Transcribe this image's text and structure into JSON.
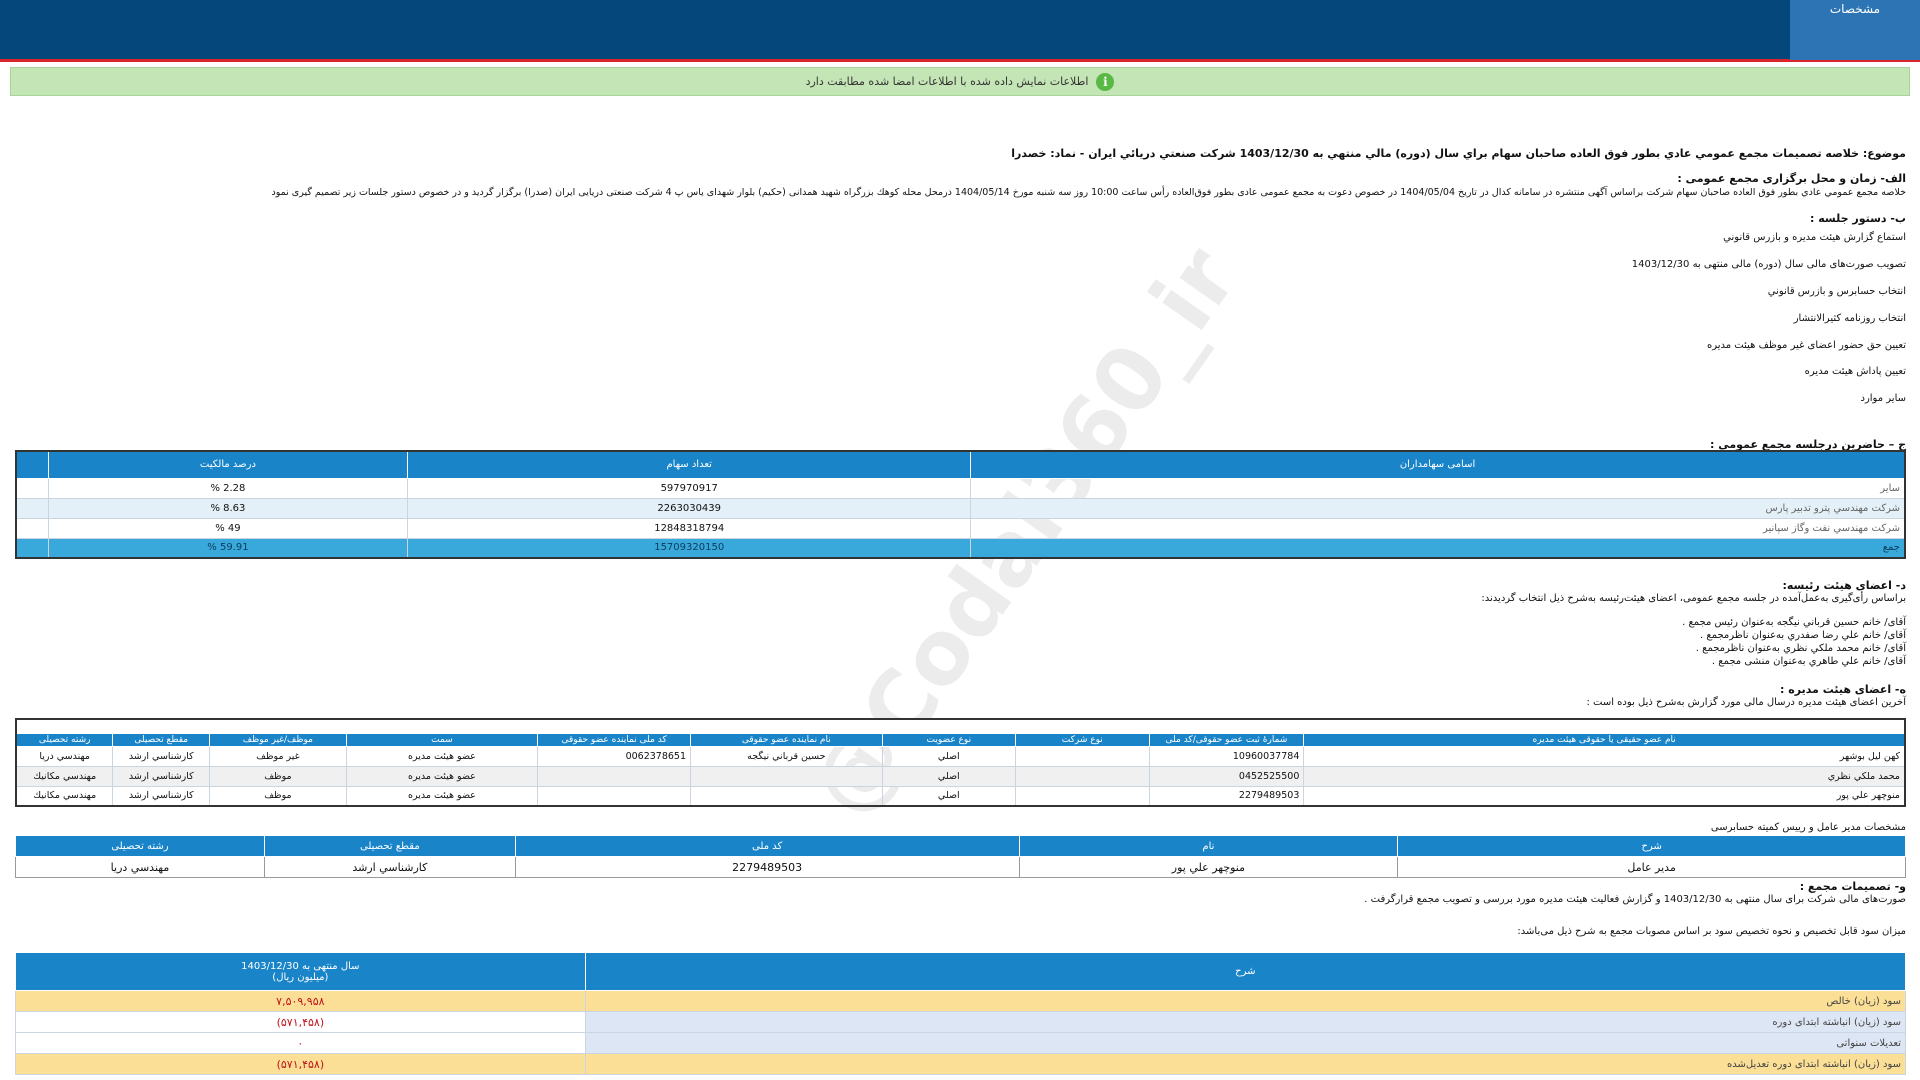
{
  "header": {
    "tab_label": "مشخصات"
  },
  "alert": {
    "text": "اطلاعات نمایش داده شده با اطلاعات امضا شده مطابقت دارد"
  },
  "watermark": "@Codal360_ir",
  "subject": "موضوع: خلاصه تصمیمات مجمع عمومي عادي بطور فوق العاده صاحبان سهام براي سال (دوره) مالي منتهي به 1403/12/30 شركت صنعتي دريائي ايران - نماد: خصدرا",
  "section_a": {
    "title": "الف- زمان و محل برگزاری مجمع عمومی :",
    "text": "خلاصه مجمع عمومي عادي بطور فوق العاده صاحبان سهام شرکت براساس آگهی منتشره در سامانه کدال در تاريخ 1404/05/04 در خصوص دعوت به مجمع عمومی عادی بطور فوق‌العاده رأس ساعت 10:00 روز سه شنبه مورخ 1404/05/14 درمحل  محله کوهك بزرگراه شهید همدانی (حکیم) بلوار شهدای یاس پ 4 شرکت صنعتی دریایی ایران (صدرا)   برگزار گرديد و در خصوص دستور جلسات زير تصميم گيری نمود"
  },
  "section_b": {
    "title": "ب- دستور جلسه :",
    "items": [
      "استماع گزارش هيئت مديره و بازرس قانوني",
      "تصويب صورت‌های مالی سال (دوره) مالی منتهی به 1403/12/30",
      "انتخاب حسابرس و بازرس قانوني",
      "انتخاب روزنامه کثيرالانتشار",
      "تعيين حق حضور اعضای غير موظف هيئت مديره",
      "تعيين پاداش هيئت مديره",
      "ساير موارد"
    ]
  },
  "section_c": {
    "title": "ج – حاضرين درجلسه مجمع عمومی :",
    "headers": [
      "اسامی سهامداران",
      "تعداد سهام",
      "درصد مالکيت"
    ],
    "rows": [
      {
        "name": "سایر",
        "shares": "597970917",
        "percent": "2.28 %"
      },
      {
        "name": "شرکت مهندسي پترو تدبير پارس",
        "shares": "2263030439",
        "percent": "8.63 %"
      },
      {
        "name": "شرکت مهندسي نفت وگاز سپانير",
        "shares": "12848318794",
        "percent": "49 %"
      }
    ],
    "total": {
      "name": "جمع",
      "shares": "15709320150",
      "percent": "59.91 %"
    }
  },
  "section_d": {
    "title": "د- اعضای هيئت رئيسه:",
    "intro": "براساس رأی‌گيری به‌عمل‌آمده در جلسه مجمع عمومی، اعضای هيئت‌رئيسه به‌شرح ذيل انتخاب گرديدند:",
    "members": [
      "آقای/ خانم  حسين قرباني نيگجه  به‌عنوان رئيس مجمع .",
      "آقای/ خانم  علي رضا صفدري  به‌عنوان ناظرمجمع .",
      "آقای/ خانم  محمد ملكي نظري  به‌عنوان ناظرمجمع .",
      "آقای/ خانم  علي طاهري  به‌عنوان منشی مجمع ."
    ]
  },
  "section_e": {
    "title": "ه- اعضای هيئت مديره :",
    "intro": "آخرين اعضای هيئت مديره درسال مالی مورد گزارش به‌شرح ذيل بوده است :",
    "headers": [
      "نام عضو حقیقی یا حقوقی هیئت مدیره",
      "شمارۀ ثبت عضو حقوقی/کد ملی",
      "نوع شرکت",
      "نوع عضویت",
      "نام نماینده عضو حقوقی",
      "کد ملی نماینده عضو حقوقی",
      "سمت",
      "موظف/غیر موظف",
      "مقطع تحصیلی",
      "رشته تحصیلی"
    ],
    "rows": [
      [
        "كهن ليل بوشهر",
        "10960037784",
        "",
        "اصلي",
        "حسين قرباني نيگجه",
        "0062378651",
        "عضو هيئت مديره",
        "غير موظف",
        "كارشناسي ارشد",
        "مهندسي دريا"
      ],
      [
        "محمد ملكي نظري",
        "0452525500",
        "",
        "اصلي",
        "",
        "",
        "عضو هيئت مديره",
        "موظف",
        "كارشناسي ارشد",
        "مهندسي مكانيك"
      ],
      [
        "منوچهر علي پور",
        "2279489503",
        "",
        "اصلي",
        "",
        "",
        "عضو هيئت مديره",
        "موظف",
        "كارشناسي ارشد",
        "مهندسي مكانيك"
      ]
    ]
  },
  "ceo": {
    "title": "مشخصات مدیر عامل و رییس کمیته حسابرسی",
    "headers": [
      "شرح",
      "نام",
      "کد ملی",
      "مقطع تحصیلی",
      "رشته تحصیلی"
    ],
    "row": [
      "مدير عامل",
      "منوچهر علي پور",
      "2279489503",
      "كارشناسي ارشد",
      "مهندسي دريا"
    ]
  },
  "section_f": {
    "title": "و- تصميمات مجمع :",
    "text1": "صورت‌های مالی شرکت برای سال منتهی به  1403/12/30 و گزارش فعاليت هيئت مديره مورد بررسی و تصويب مجمع قرارگرفت .",
    "text2": "ميزان سود قابل تخصيص و نحوه تخصيص سود بر اساس مصوبات مجمع به شرح ذيل می‌باشد:",
    "headers": {
      "desc": "شرح",
      "year_l1": "سال منتهی به 1403/12/30",
      "year_l2": "(میلیون ریال)"
    },
    "rows": [
      {
        "desc": "سود (زيان) خالص",
        "value": "۷,۵۰۹,۹۵۸"
      },
      {
        "desc": "سود (زيان) انباشته ابتدای دوره",
        "value": "(۵۷۱,۴۵۸)"
      },
      {
        "desc": "تعديلات سنواتی",
        "value": "۰"
      },
      {
        "desc": "سود (زيان) انباشته ابتدای دوره تعديل‌شده",
        "value": "(۵۷۱,۴۵۸)"
      }
    ]
  }
}
